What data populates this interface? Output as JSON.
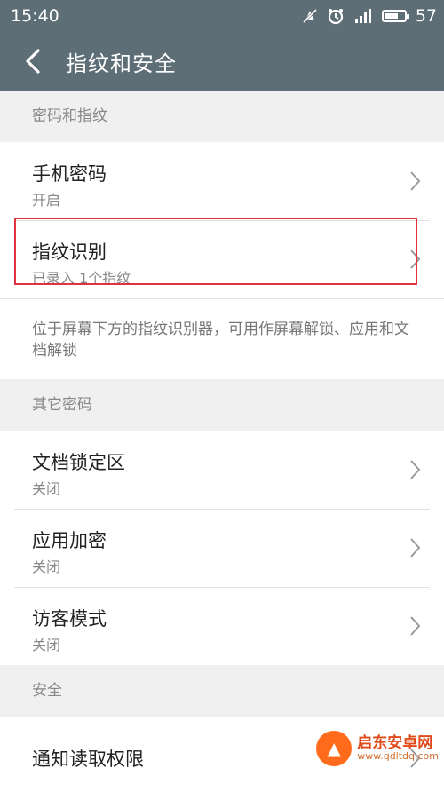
{
  "status_bar": {
    "time": "15:40",
    "battery": "57",
    "icons": [
      "mute-icon",
      "alarm-icon",
      "signal-icon",
      "battery-icon"
    ]
  },
  "app_bar": {
    "title": "指纹和安全"
  },
  "sections": {
    "fingerprint": {
      "header": "密码和指纹",
      "phone_password": {
        "title": "手机密码",
        "subtitle": "开启"
      },
      "fingerprint_id": {
        "title": "指纹识别",
        "subtitle": "已录入 1个指纹"
      },
      "description": "位于屏幕下方的指纹识别器，可用作屏幕解锁、应用和文档解锁"
    },
    "other": {
      "header": "其它密码",
      "doc_lock": {
        "title": "文档锁定区",
        "subtitle": "关闭"
      },
      "app_lock": {
        "title": "应用加密",
        "subtitle": "关闭"
      },
      "guest_mode": {
        "title": "访客模式",
        "subtitle": "关闭"
      }
    },
    "security": {
      "header": "安全",
      "notification_access": {
        "title": "通知读取权限"
      }
    }
  },
  "watermark": {
    "name": "启东安卓网",
    "url": "www.qdltdq.com"
  },
  "colors": {
    "toolbar": "#5e6e76",
    "highlight": "#e0323f",
    "background": "#f0f0f0"
  }
}
